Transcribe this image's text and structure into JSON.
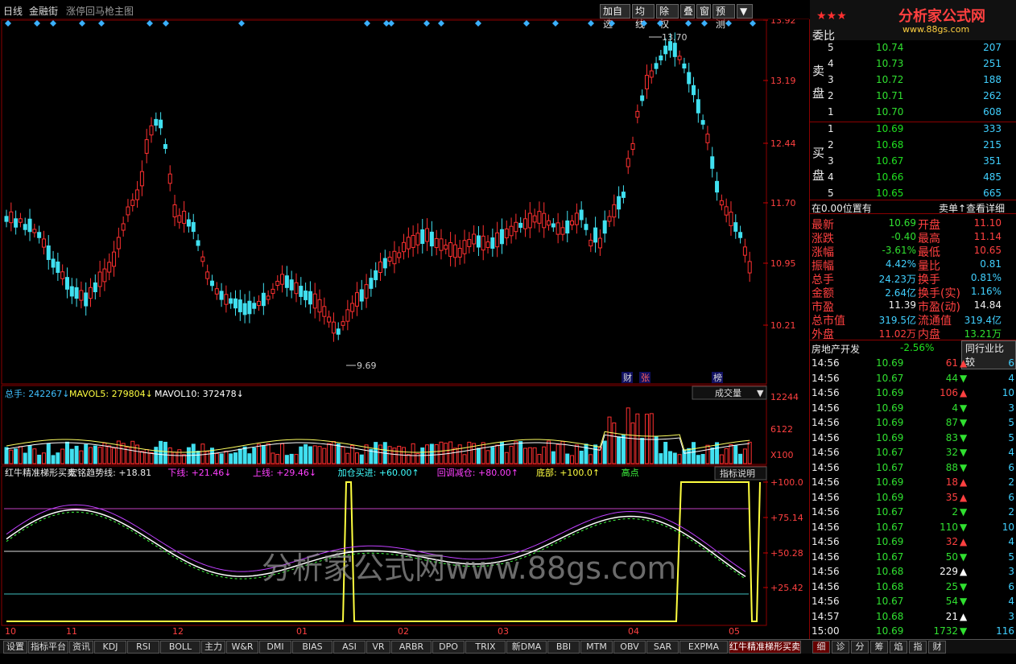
{
  "topbar": {
    "period": "日线",
    "stock": "金融街",
    "formula": "涨停回马枪主图",
    "buttons": [
      "加自选",
      "均线",
      "除权",
      "叠",
      "窗",
      "预测",
      "▼"
    ]
  },
  "price_axis": [
    "13.92",
    "13.19",
    "12.44",
    "11.70",
    "10.95",
    "10.21"
  ],
  "price_marks": {
    "high": "13.70",
    "low": "9.69"
  },
  "events": [
    "财",
    "张",
    "榜"
  ],
  "volume": {
    "label": "总手:",
    "value": "242267",
    "mavol5_label": "MAVOL5:",
    "mavol5": "279804",
    "mavol10_label": "MAVOL10:",
    "mavol10": "372478",
    "select": "成交量",
    "axis": [
      "12244",
      "6122",
      "X100"
    ]
  },
  "indicator": {
    "name": "红牛精准梯形买卖",
    "trend_label": "宏铭趋势线:",
    "trend": "+18.81",
    "down_label": "下线:",
    "down": "+21.46",
    "up_label": "上线:",
    "up": "+29.46",
    "add_label": "加仓买进:",
    "add": "+60.00",
    "reduce_label": "回调减仓:",
    "reduce": "+80.00",
    "bottom_label": "底部:",
    "bottom": "+100.0",
    "top_label": "高点",
    "help": "指标说明",
    "axis": [
      "+100.0",
      "+75.14",
      "+50.28",
      "+25.42"
    ]
  },
  "months": [
    "10",
    "11",
    "12",
    "01",
    "02",
    "03",
    "04",
    "05"
  ],
  "watermark": "分析家公式网www.88gs.com",
  "tabs": [
    "设置",
    "指标平台",
    "资讯",
    "KDJ",
    "RSI",
    "BOLL",
    "主力",
    "W&R",
    "DMI",
    "BIAS",
    "ASI",
    "VR",
    "ARBR",
    "DPO",
    "TRIX",
    "新DMA",
    "BBI",
    "MTM",
    "OBV",
    "SAR",
    "EXPMA",
    "红牛精准梯形买卖"
  ],
  "logo": {
    "title": "分析家公式网",
    "url": "www.88gs.com"
  },
  "orderbook": {
    "header": "委比",
    "sell_label": "卖盘",
    "buy_label": "买盘",
    "sell": [
      {
        "n": "5",
        "p": "10.74",
        "v": "207"
      },
      {
        "n": "4",
        "p": "10.73",
        "v": "251"
      },
      {
        "n": "3",
        "p": "10.72",
        "v": "188"
      },
      {
        "n": "2",
        "p": "10.71",
        "v": "262"
      },
      {
        "n": "1",
        "p": "10.70",
        "v": "608"
      }
    ],
    "buy": [
      {
        "n": "1",
        "p": "10.69",
        "v": "333"
      },
      {
        "n": "2",
        "p": "10.68",
        "v": "215"
      },
      {
        "n": "3",
        "p": "10.67",
        "v": "351"
      },
      {
        "n": "4",
        "p": "10.66",
        "v": "485"
      },
      {
        "n": "5",
        "p": "10.65",
        "v": "665"
      }
    ]
  },
  "pos": {
    "left": "在0.00位置有",
    "right": "卖单↑查看详细"
  },
  "quote": [
    [
      "最新",
      "10.69",
      "开盘",
      "11.10"
    ],
    [
      "涨跌",
      "-0.40",
      "最高",
      "11.14"
    ],
    [
      "涨幅",
      "-3.61%",
      "最低",
      "10.65"
    ],
    [
      "振幅",
      "4.42%",
      "量比",
      "0.81"
    ],
    [
      "总手",
      "24.23万",
      "换手",
      "0.81%"
    ],
    [
      "金额",
      "2.64亿",
      "换手(实)",
      "1.16%"
    ],
    [
      "市盈",
      "11.39",
      "市盈(动)",
      "14.84"
    ],
    [
      "总市值",
      "319.5亿",
      "流通值",
      "319.4亿"
    ],
    [
      "外盘",
      "11.02万",
      "内盘",
      "13.21万"
    ]
  ],
  "industry": {
    "name": "房地产开发",
    "chg": "-2.56%",
    "btn": "同行业比较"
  },
  "ticks": [
    [
      "14:56",
      "10.69",
      "61",
      "up",
      "6"
    ],
    [
      "14:56",
      "10.67",
      "44",
      "dn",
      "4"
    ],
    [
      "14:56",
      "10.69",
      "106",
      "up",
      "10"
    ],
    [
      "14:56",
      "10.69",
      "4",
      "dn",
      "3"
    ],
    [
      "14:56",
      "10.69",
      "87",
      "dn",
      "5"
    ],
    [
      "14:56",
      "10.69",
      "83",
      "dn",
      "5"
    ],
    [
      "14:56",
      "10.67",
      "32",
      "dn",
      "4"
    ],
    [
      "14:56",
      "10.67",
      "88",
      "dn",
      "6"
    ],
    [
      "14:56",
      "10.69",
      "18",
      "up",
      "2"
    ],
    [
      "14:56",
      "10.69",
      "35",
      "up",
      "6"
    ],
    [
      "14:56",
      "10.67",
      "2",
      "dn",
      "2"
    ],
    [
      "14:56",
      "10.67",
      "110",
      "dn",
      "10"
    ],
    [
      "14:56",
      "10.69",
      "32",
      "up",
      "4"
    ],
    [
      "14:56",
      "10.67",
      "50",
      "dn",
      "5"
    ],
    [
      "14:56",
      "10.68",
      "229",
      "wt",
      "3"
    ],
    [
      "14:56",
      "10.68",
      "25",
      "dn",
      "6"
    ],
    [
      "14:56",
      "10.67",
      "54",
      "dn",
      "4"
    ],
    [
      "14:57",
      "10.68",
      "21",
      "wt",
      "3"
    ],
    [
      "15:00",
      "10.69",
      "1732",
      "dn",
      "116"
    ]
  ],
  "rtabs": [
    "细",
    "诊",
    "分",
    "筹",
    "焰",
    "指",
    "财"
  ]
}
